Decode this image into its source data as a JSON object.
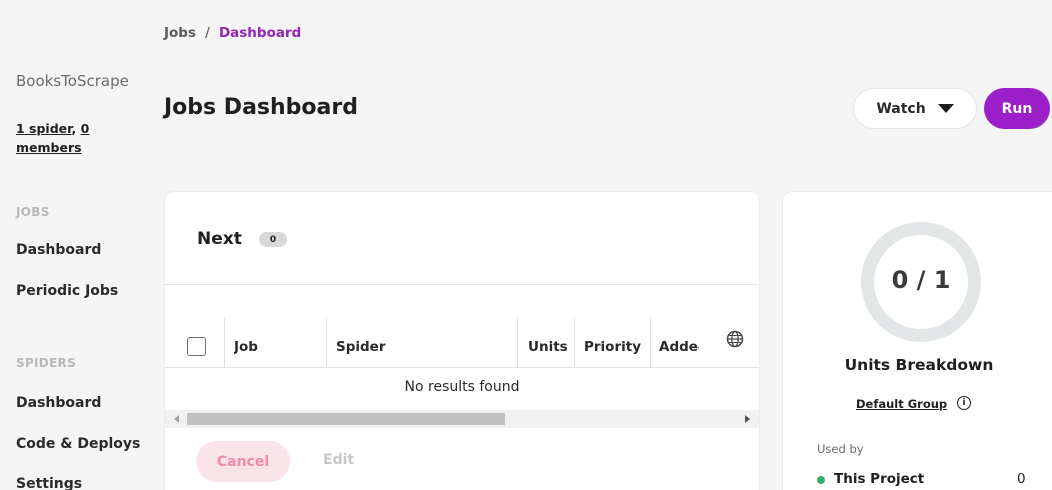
{
  "breadcrumb": {
    "items": [
      "Jobs",
      "Dashboard"
    ],
    "separator": "/"
  },
  "project": {
    "name": "BooksToScrape",
    "spiders_link": "1 spider",
    "comma": ", ",
    "members_link": "0 members"
  },
  "sidebar": {
    "sections": [
      {
        "title": "JOBS",
        "items": [
          "Dashboard",
          "Periodic Jobs"
        ]
      },
      {
        "title": "SPIDERS",
        "items": [
          "Dashboard",
          "Code & Deploys",
          "Settings"
        ]
      }
    ]
  },
  "header": {
    "title": "Jobs Dashboard",
    "watch_label": "Watch",
    "run_label": "Run"
  },
  "jobs_panel": {
    "title": "Next",
    "count": "0",
    "columns": [
      "Job",
      "Spider",
      "Units",
      "Priority",
      "Added"
    ],
    "empty_text": "No results found",
    "cancel_label": "Cancel",
    "edit_label": "Edit"
  },
  "units_panel": {
    "ring_value": "0 / 1",
    "units_used": 0,
    "units_total": 1,
    "title": "Units Breakdown",
    "group_link": "Default Group",
    "used_by_label": "Used by",
    "usage": [
      {
        "name": "This Project",
        "value": "0"
      }
    ]
  },
  "colors": {
    "accent": "#9b1fc8",
    "breadcrumb_current": "#9324b8",
    "cancel_bg": "#fbe3ea",
    "cancel_text": "#f08aa7",
    "status_green": "#2fb36b",
    "ring": "#e3e6e6"
  },
  "icons": {
    "watch_caret": "caret-down-icon",
    "column_settings": "globe-icon",
    "group_info": "info-icon"
  }
}
